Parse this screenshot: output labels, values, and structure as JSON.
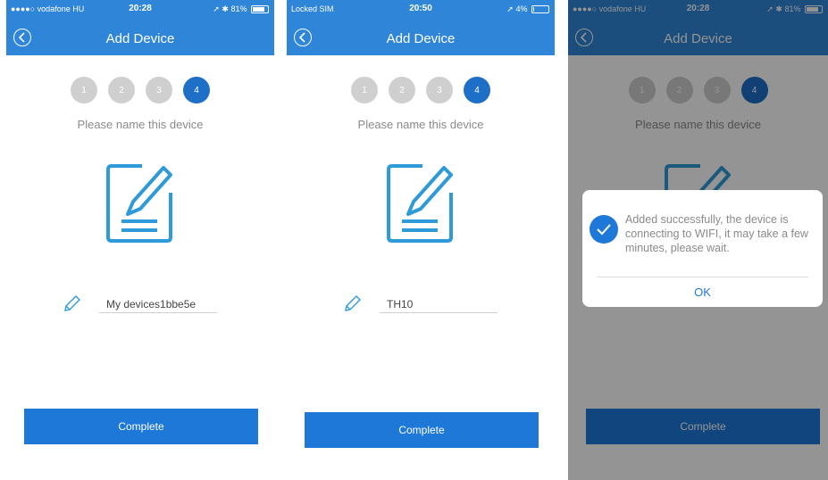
{
  "screens": [
    {
      "status": {
        "carrier": "●●●●○ vodafone HU",
        "time": "20:28",
        "right": "81%",
        "battery_level": 0.81
      },
      "nav_title": "Add Device",
      "steps": [
        "1",
        "2",
        "3",
        "4"
      ],
      "prompt": "Please name this device",
      "device_name": "My devices1bbe5e",
      "complete_label": "Complete"
    },
    {
      "status": {
        "carrier": "Locked SIM",
        "time": "20:50",
        "right": "4%",
        "battery_level": 0.04
      },
      "nav_title": "Add Device",
      "steps": [
        "1",
        "2",
        "3",
        "4"
      ],
      "prompt": "Please name this device",
      "device_name": "TH10",
      "complete_label": "Complete"
    },
    {
      "status": {
        "carrier": "●●●●○ vodafone HU",
        "time": "20:28",
        "right": "81%",
        "battery_level": 0.81
      },
      "nav_title": "Add Device",
      "steps": [
        "1",
        "2",
        "3",
        "4"
      ],
      "prompt": "Please name this device",
      "complete_label": "Complete",
      "alert": {
        "message": "Added successfully, the device is connecting to WIFI, it may take a few minutes, please wait.",
        "ok_label": "OK"
      }
    }
  ],
  "colors": {
    "primary": "#2f86d8",
    "button": "#1e78d8",
    "step_active": "#1e6fc8",
    "step_inactive": "#cfcfcf"
  },
  "active_step": "4"
}
